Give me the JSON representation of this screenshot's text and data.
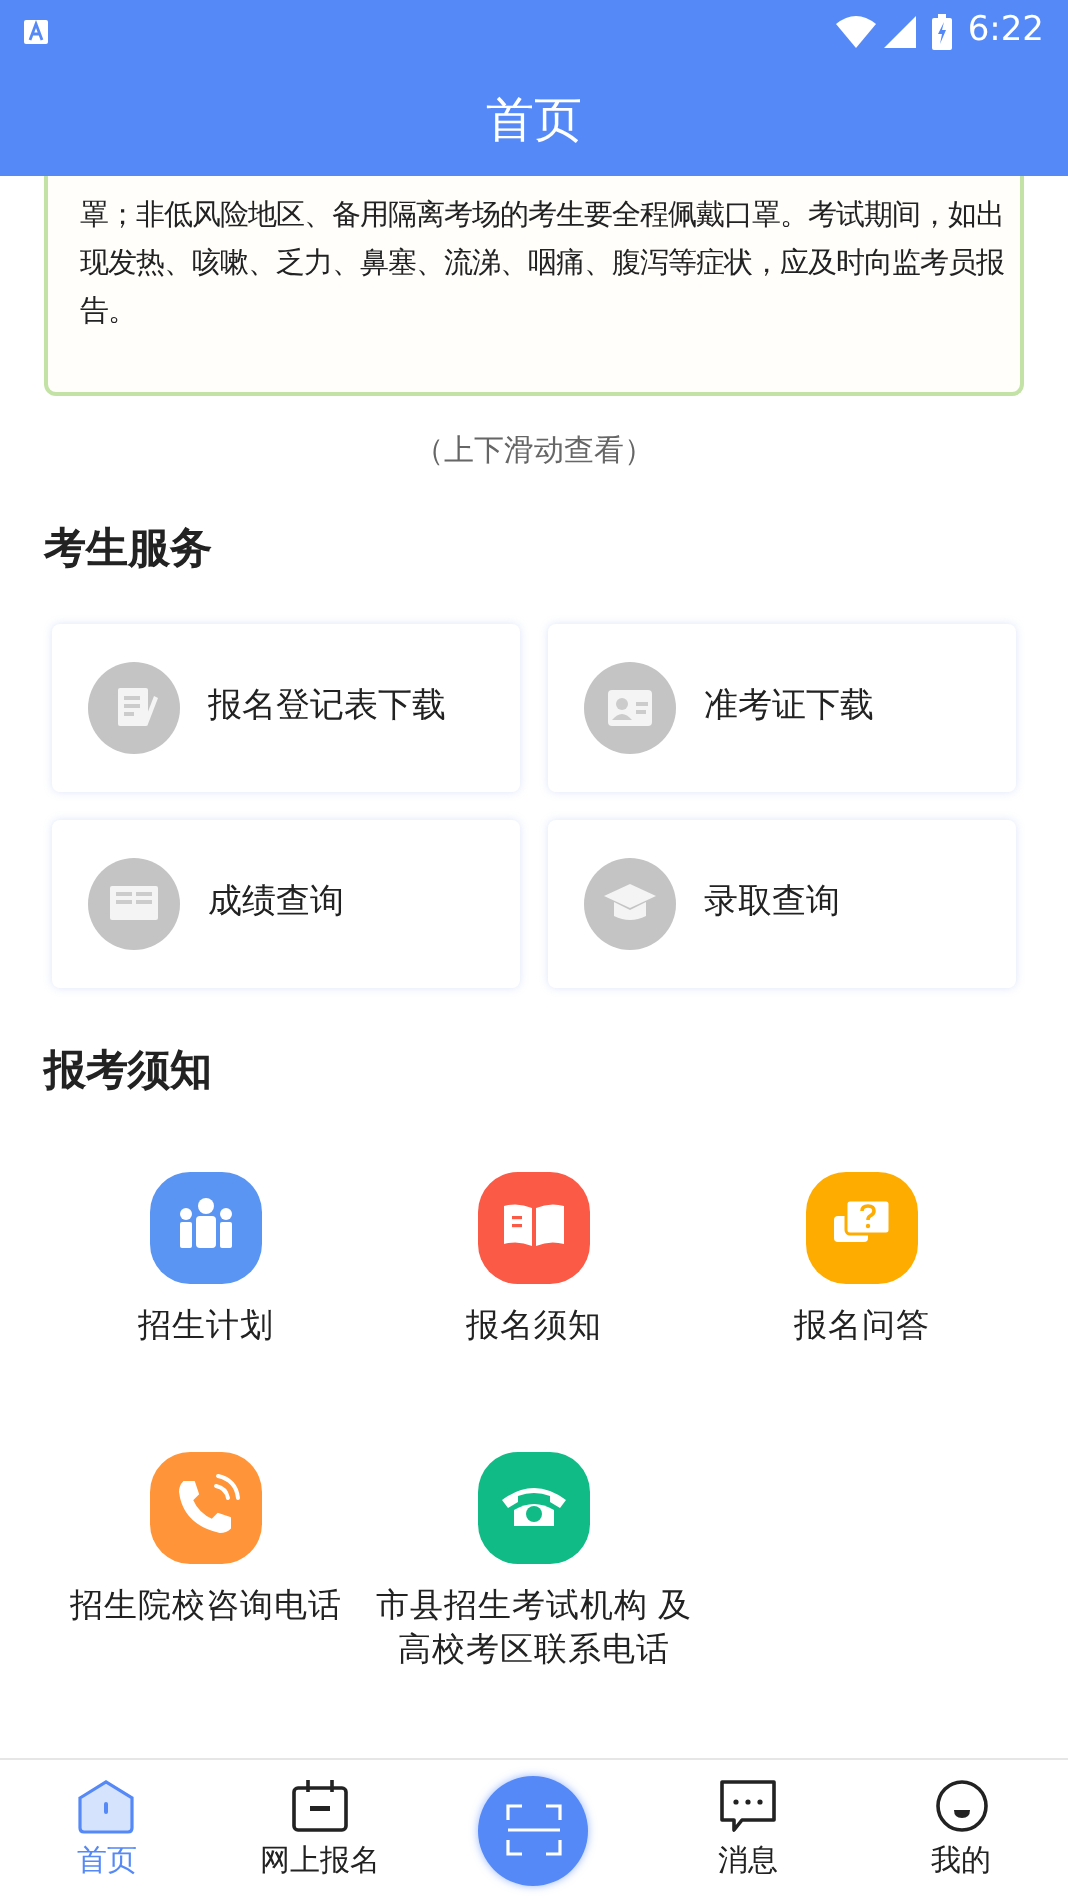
{
  "status_bar": {
    "time": "6:22"
  },
  "header": {
    "title": "首页"
  },
  "notice": {
    "text": "罩；非低风险地区、备用隔离考场的考生要全程佩戴口罩。考试期间，如出现发热、咳嗽、乏力、鼻塞、流涕、咽痛、腹泻等症状，应及时向监考员报告。",
    "hint": "（上下滑动查看）"
  },
  "services": {
    "title": "考生服务",
    "items": [
      {
        "label": "报名登记表下载",
        "kind": "form"
      },
      {
        "label": "准考证下载",
        "kind": "card"
      },
      {
        "label": "成绩查询",
        "kind": "book"
      },
      {
        "label": "录取查询",
        "kind": "cap"
      }
    ]
  },
  "guide": {
    "title": "报考须知",
    "items": [
      {
        "label": "招生计划",
        "kind": "people",
        "color": "#5b95f3"
      },
      {
        "label": "报名须知",
        "kind": "book",
        "color": "#fa5a46"
      },
      {
        "label": "报名问答",
        "kind": "qa",
        "color": "#ffac00"
      },
      {
        "label": "招生院校咨询电话",
        "kind": "phone",
        "color": "#ff9538"
      },
      {
        "label": "市县招生考试机构 及高校考区联系电话",
        "kind": "landline",
        "color": "#11bb85"
      }
    ]
  },
  "nav": [
    {
      "label": "首页",
      "kind": "home",
      "selected": true
    },
    {
      "label": "网上报名",
      "kind": "calendar",
      "selected": false
    },
    {
      "kind": "scan",
      "selected": false
    },
    {
      "label": "消息",
      "kind": "chat",
      "selected": false
    },
    {
      "label": "我的",
      "kind": "face",
      "selected": false
    }
  ]
}
